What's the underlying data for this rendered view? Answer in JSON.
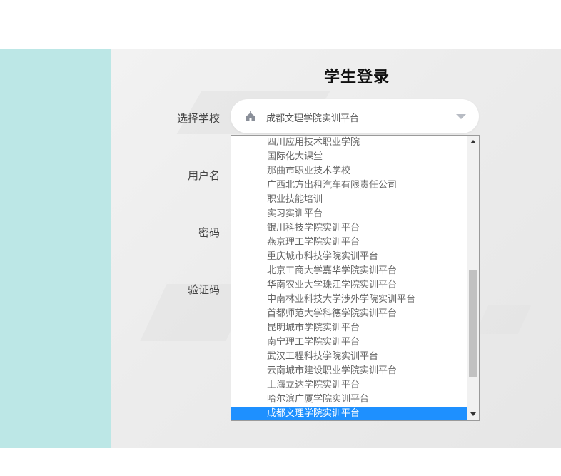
{
  "page": {
    "title": "学生登录"
  },
  "form": {
    "school_label": "选择学校",
    "username_label": "用户名",
    "password_label": "密码",
    "captcha_label": "验证码",
    "school_selected": "成都文理学院实训平台",
    "school_icon": "school-building-icon"
  },
  "dropdown": {
    "options": [
      "四川应用技术职业学院",
      "国际化大课堂",
      "那曲市职业技术学校",
      "广西北方出租汽车有限责任公司",
      "职业技能培训",
      "实习实训平台",
      "银川科技学院实训平台",
      "燕京理工学院实训平台",
      "重庆城市科技学院实训平台",
      "北京工商大学嘉华学院实训平台",
      "华南农业大学珠江学院实训平台",
      "中南林业科技大学涉外学院实训平台",
      "首都师范大学科德学院实训平台",
      "昆明城市学院实训平台",
      "南宁理工学院实训平台",
      "武汉工程科技学院实训平台",
      "云南城市建设职业学院实训平台",
      "上海立达学院实训平台",
      "哈尔滨广厦学院实训平台",
      "成都文理学院实训平台"
    ],
    "selected_index": 19
  },
  "colors": {
    "accent_left_band": "#bce7e6",
    "selected_option": "#1e90ff"
  }
}
